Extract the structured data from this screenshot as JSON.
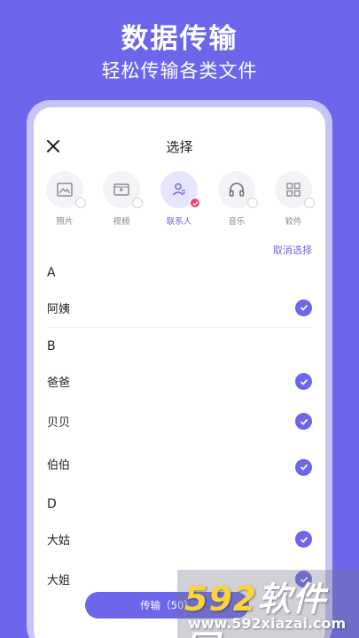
{
  "hero": {
    "title": "数据传输",
    "subtitle": "轻松传输各类文件"
  },
  "header": {
    "title": "选择",
    "close_icon": "close-icon"
  },
  "categories": [
    {
      "label": "照片",
      "icon": "photo-icon",
      "active": false
    },
    {
      "label": "视频",
      "icon": "video-icon",
      "active": false
    },
    {
      "label": "联系人",
      "icon": "contact-icon",
      "active": true
    },
    {
      "label": "音乐",
      "icon": "headphones-icon",
      "active": false
    },
    {
      "label": "软件",
      "icon": "apps-grid-icon",
      "active": false
    }
  ],
  "deselect_label": "取消选择",
  "sections": [
    {
      "letter": "A",
      "contacts": [
        "阿姨"
      ]
    },
    {
      "letter": "B",
      "contacts": [
        "爸爸",
        "贝贝",
        "伯伯"
      ]
    },
    {
      "letter": "D",
      "contacts": [
        "大姑",
        "大姐"
      ]
    }
  ],
  "transfer_button": "传输（50）",
  "watermark": {
    "logo_num": "592",
    "logo_text": "软件园",
    "url": "www.592xiazai.com"
  },
  "colors": {
    "accent": "#6b66ec",
    "badge": "#f04470",
    "frame": "#c7c4fa"
  }
}
